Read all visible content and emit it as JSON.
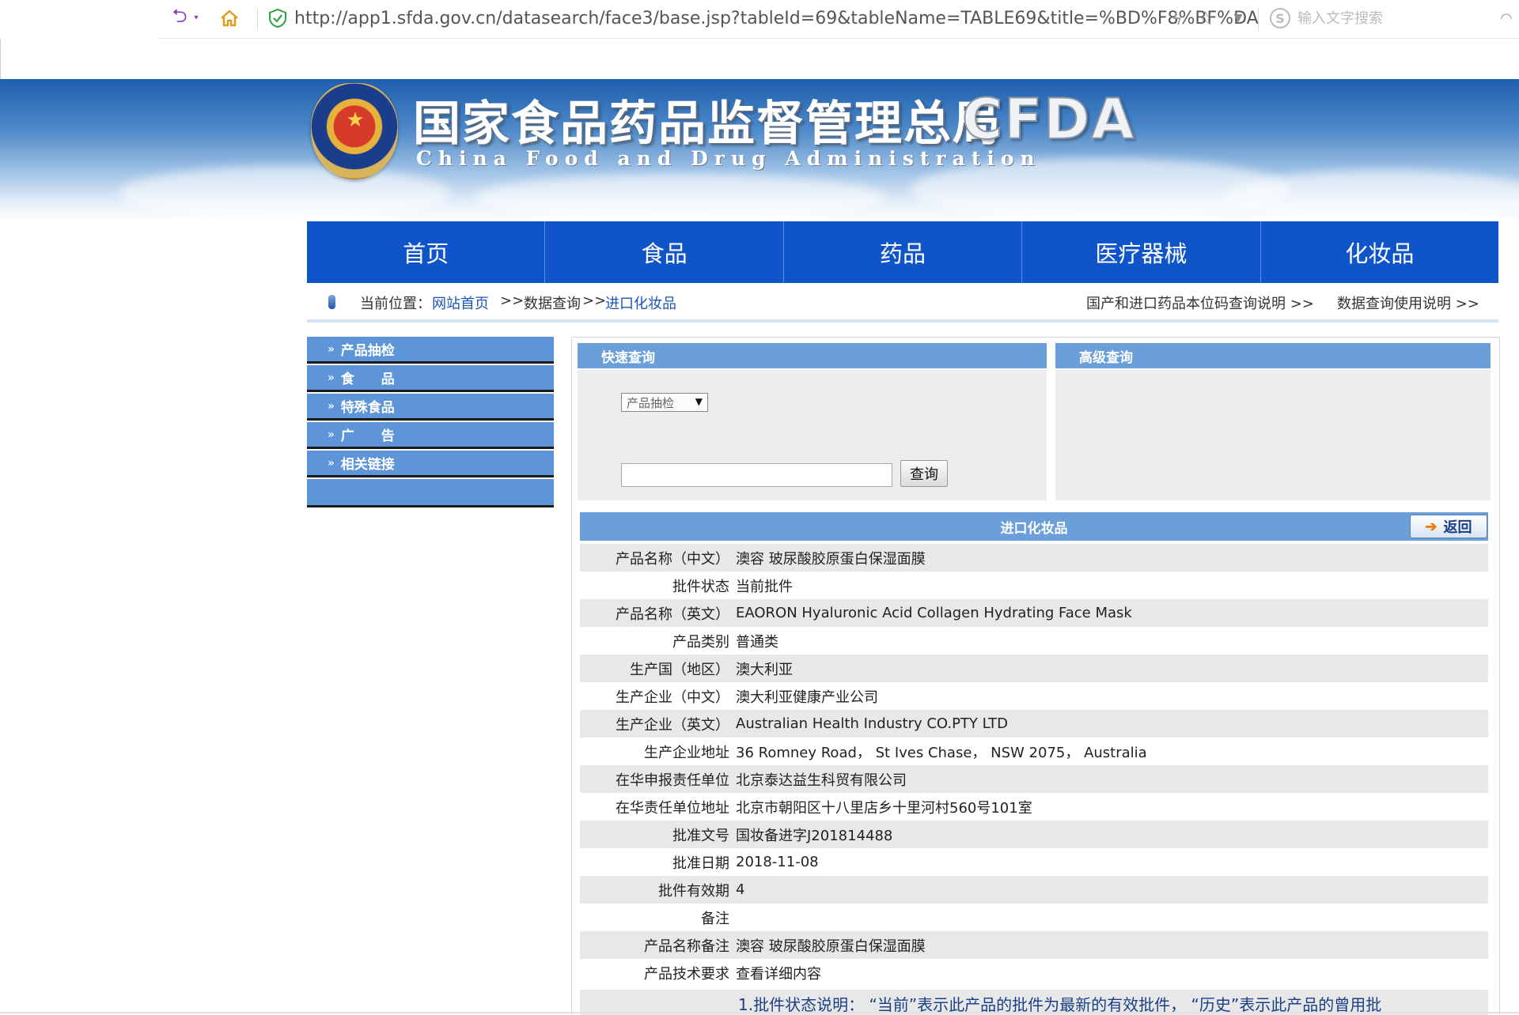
{
  "browser": {
    "url": "http://app1.sfda.gov.cn/datasearch/face3/base.jsp?tableId=69&tableName=TABLE69&title=%BD%F8%BF%DA",
    "search_placeholder": "输入文字搜索"
  },
  "header": {
    "title_cn": "国家食品药品监督管理总局",
    "title_en": "China Food and Drug Administration",
    "logo_text": "CFDA"
  },
  "nav": {
    "items": [
      {
        "label": "首页"
      },
      {
        "label": "食品"
      },
      {
        "label": "药品"
      },
      {
        "label": "医疗器械"
      },
      {
        "label": "化妆品"
      }
    ]
  },
  "breadcrumb": {
    "label": "当前位置：",
    "home": "网站首页",
    "sep1": ">>",
    "data_query": "数据查询",
    "sep2": ">>",
    "current": "进口化妆品",
    "right_link_1": "国产和进口药品本位码查询说明 >>",
    "right_link_2": "数据查询使用说明 >>"
  },
  "sidebar": {
    "items": [
      {
        "label": "产品抽检"
      },
      {
        "label": "食　　品"
      },
      {
        "label": "特殊食品"
      },
      {
        "label": "广　　告"
      },
      {
        "label": "相关链接"
      }
    ]
  },
  "quick_search": {
    "title": "快速查询",
    "select_value": "产品抽检",
    "input_value": "",
    "button_label": "查询"
  },
  "advanced_search": {
    "title": "高级查询"
  },
  "detail": {
    "title": "进口化妆品",
    "back_label": "返回",
    "rows": [
      {
        "label": "产品名称（中文）",
        "value": "澳容 玻尿酸胶原蛋白保湿面膜"
      },
      {
        "label": "批件状态",
        "value": "当前批件"
      },
      {
        "label": "产品名称（英文）",
        "value": "EAORON Hyaluronic Acid Collagen Hydrating Face Mask"
      },
      {
        "label": "产品类别",
        "value": "普通类"
      },
      {
        "label": "生产国（地区）",
        "value": "澳大利亚"
      },
      {
        "label": "生产企业（中文）",
        "value": "澳大利亚健康产业公司"
      },
      {
        "label": "生产企业（英文）",
        "value": "Australian Health Industry CO.PTY LTD"
      },
      {
        "label": "生产企业地址",
        "value": "36 Romney Road， St Ives Chase， NSW 2075， Australia"
      },
      {
        "label": "在华申报责任单位",
        "value": "北京泰达益生科贸有限公司"
      },
      {
        "label": "在华责任单位地址",
        "value": "北京市朝阳区十八里店乡十里河村560号101室"
      },
      {
        "label": "批准文号",
        "value": "国妆备进字J201814488"
      },
      {
        "label": "批准日期",
        "value": "2018-11-08"
      },
      {
        "label": "批件有效期",
        "value": "4"
      },
      {
        "label": "备注",
        "value": ""
      },
      {
        "label": "产品名称备注",
        "value": "澳容 玻尿酸胶原蛋白保湿面膜"
      },
      {
        "label": "产品技术要求",
        "value": "查看详细内容"
      }
    ],
    "note": "1.批件状态说明：  “当前”表示此产品的批件为最新的有效批件，  “历史”表示此产品的曾用批"
  }
}
